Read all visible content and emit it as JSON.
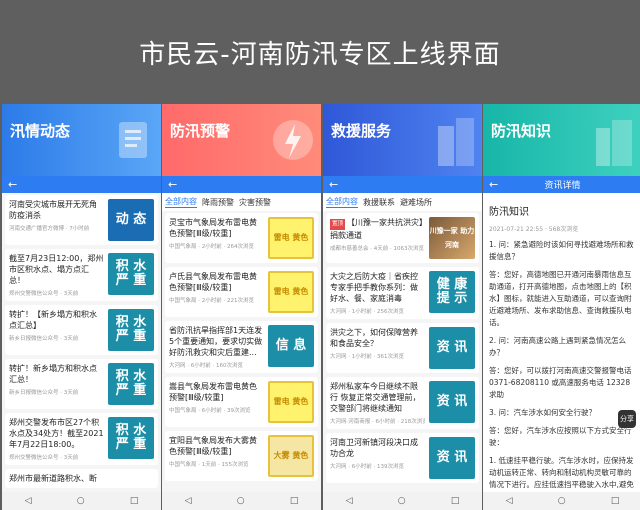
{
  "header": {
    "title": "市民云-河南防汛专区上线界面"
  },
  "colors": {
    "primary": "#2d7cf2",
    "info_blue": "#1a6db3",
    "warn_yellow": "#f5e6a4"
  },
  "panels": [
    {
      "banner": "汛情动态",
      "items": [
        {
          "title": "河南受灾城市展开无死角防疫消杀",
          "meta": "河南交通广播官方微博 · 7小时前",
          "thumb": "动 态"
        },
        {
          "title": "截至7月23日12:00，郑州市区积水点、塌方点汇总！",
          "meta": "郑州交警微信公众号 · 3天前",
          "thumb": "积 水 严 重"
        },
        {
          "title": "转扩！【新乡塌方和积水点汇总】",
          "meta": "新乡日报微信公众号 · 3天前",
          "thumb": "积 水 严 重"
        },
        {
          "title": "转扩！新乡塌方和积水点汇总！",
          "meta": "新乡日报微信公众号 · 3天前",
          "thumb": "积 水 严 重"
        },
        {
          "title": "郑州交警发布市区27个积水点及34处方！截至2021年7月22日18:00。",
          "meta": "郑州交警微信公众号 · 3天前",
          "thumb": "积 水 严 重"
        },
        {
          "title": "郑州市最新道路积水、断",
          "meta": "",
          "thumb": ""
        }
      ]
    },
    {
      "banner": "防汛预警",
      "tabs": [
        "全部内容",
        "降雨预警",
        "灾害预警"
      ],
      "items": [
        {
          "title": "灵宝市气象局发布雷电黄色预警[Ⅲ级/较重]",
          "meta": "中国气象局 · 2小时前 · 264次浏览",
          "thumb": "雷电 黄色"
        },
        {
          "title": "卢氏县气象局发布雷电黄色预警[Ⅲ级/较重]",
          "meta": "中国气象局 · 2小时前 · 221次浏览",
          "thumb": "雷电 黄色"
        },
        {
          "title": "省防汛抗旱指挥部1天连发5个重要通知，要求切实做好防汛救灾和灾后重建...",
          "meta": "大河网 · 6小时前 · 160次浏览",
          "thumb": "信 息"
        },
        {
          "title": "嵩县气象局发布雷电黄色预警[Ⅲ级/较重]",
          "meta": "中国气象局 · 6小时前 · 39次浏览",
          "thumb": "雷电 黄色"
        },
        {
          "title": "宜阳县气象局发布大雾黄色预警[Ⅲ级/较重]",
          "meta": "中国气象局 · 1天前 · 155次浏览",
          "thumb": "大雾 黄色"
        }
      ]
    },
    {
      "banner": "救援服务",
      "tabs": [
        "全部内容",
        "救援联系",
        "避难场所"
      ],
      "items": [
        {
          "tag": "置顶",
          "title": "【川豫一家共抗洪灾】捐款通道",
          "meta": "成都市慈善总会 · 4天前 · 1063次浏览",
          "thumb": "川豫一家 助力河南"
        },
        {
          "title": "大灾之后防大疫｜省疾控专家手把手教你系列：做好水、餐、家庭消毒",
          "meta": "大河网 · 1小时前 · 256次浏览",
          "thumb": "健 康 提 示"
        },
        {
          "title": "洪灾之下，如何保障营养和食品安全？",
          "meta": "大河网 · 1小时前 · 361次浏览",
          "thumb": "资 讯"
        },
        {
          "title": "郑州私家车今日继续不限行 恢复正常交通管理前，交警部门将继续通知",
          "meta": "大河网·河南商报 · 6小时前 · 218次浏览",
          "thumb": "资 讯"
        },
        {
          "title": "河南卫河新镇河段决口成功合龙",
          "meta": "大河网 · 6小时前 · 139次浏览",
          "thumb": "资 讯"
        }
      ]
    },
    {
      "banner": "防汛知识",
      "nav_title": "资讯详情",
      "article": {
        "title": "防汛知识",
        "meta": "2021-07-21 22:55 · 568次浏览",
        "paragraphs": [
          "1. 问：紧急避险时该如何寻找避难场所和救援信息？",
          "答：您好，高德地图已开通河南暴雨信息互助通道，打开高德地图，点击地图上的【积水】图标，就能进入互助通道，可以查询附近避难场所、发布求助信息、查询救援队电话。",
          "2. 问：河南高速公路上遇到紧急情况怎么办？",
          "答：您好，可以拨打河南高速交警报警电话0371-68208110 或高速服务电话 12328 求助",
          "3. 问：汽车涉水如何安全行驶？",
          "答：您好，汽车涉水应按照以下方式安全行驶：",
          "1. 低速挂平稳行驶。汽车涉水时，应保持发动机运转正常、转向和制动机构灵敏可靠的情况下进行。应挂低速挡平稳驶入水中,避免大"
        ],
        "share_label": "分享"
      }
    }
  ]
}
